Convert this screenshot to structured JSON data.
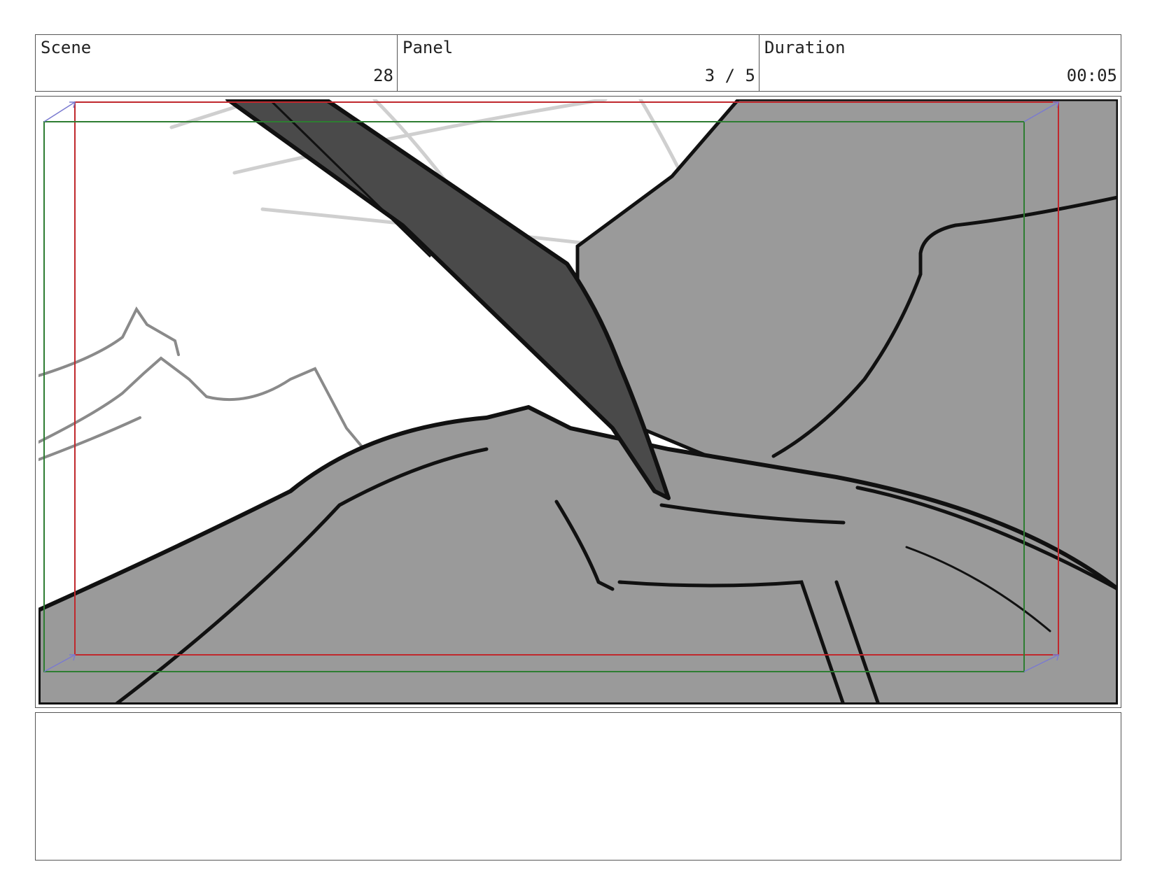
{
  "header": {
    "scene_label": "Scene",
    "scene_value": "28",
    "panel_label": "Panel",
    "panel_value": "3 / 5",
    "duration_label": "Duration",
    "duration_value": "00:05"
  },
  "notes": {
    "text": ""
  },
  "colors": {
    "border": "#555555",
    "fill_gray": "#9a9a9a",
    "blade": "#4a4a4a",
    "safe_red": "#c0282d",
    "safe_green": "#2e7d32",
    "arrow_blue": "#7a7ad0"
  }
}
